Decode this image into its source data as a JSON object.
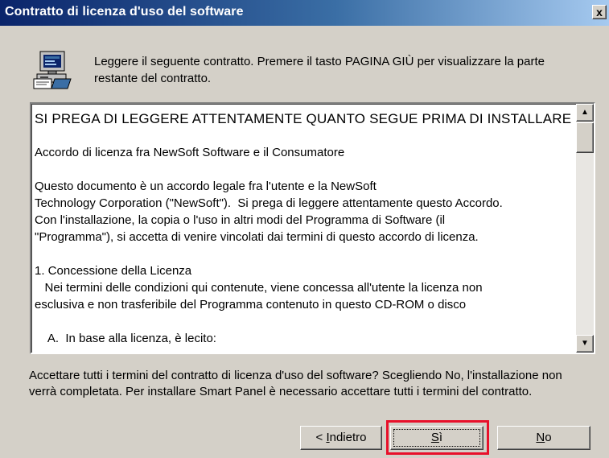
{
  "window": {
    "title": "Contratto di licenza d'uso del software",
    "close_label": "x"
  },
  "icon": "setup-computer-icon",
  "instruction": "Leggere il seguente contratto. Premere il tasto PAGINA GIÙ per visualizzare la parte restante del contratto.",
  "license": {
    "paragraphs": [
      "SI PREGA DI LEGGERE ATTENTAMENTE QUANTO SEGUE PRIMA DI INSTALLARE",
      "Accordo di licenza fra NewSoft Software e il Consumatore",
      "Questo documento è un accordo legale fra l'utente e la NewSoft\nTechnology Corporation (\"NewSoft\").  Si prega di leggere attentamente questo Accordo.\nCon l'installazione, la copia o l'uso in altri modi del Programma di Software (il\n\"Programma\"), si accetta di venire vincolati dai termini di questo accordo di licenza.",
      "1. Concessione della Licenza\n   Nei termini delle condizioni qui contenute, viene concessa all'utente la licenza non\nesclusiva e non trasferibile del Programma contenuto in questo CD-ROM o disco",
      "    A.  In base alla licenza, è lecito:"
    ]
  },
  "question": "Accettare tutti i termini del contratto di licenza d'uso del software? Scegliendo No, l'installazione non verrà completata. Per installare Smart Panel è necessario accettare tutti i termini del contratto.",
  "buttons": {
    "back_prefix": "< ",
    "back_mnemonic": "I",
    "back_rest": "ndietro",
    "yes_mnemonic": "S",
    "yes_rest": "ì",
    "no_mnemonic": "N",
    "no_rest": "o"
  },
  "colors": {
    "titlebar_start": "#0a246a",
    "titlebar_end": "#a6caf0",
    "dialog_bg": "#d4d0c8",
    "highlight": "#e8102a"
  }
}
